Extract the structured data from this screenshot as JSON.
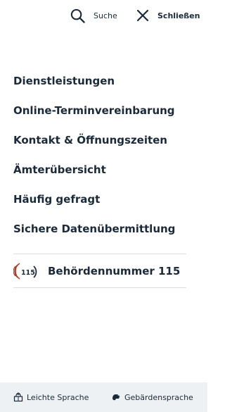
{
  "header": {
    "search_label": "Suche",
    "close_label": "Schließen"
  },
  "menu": {
    "items": [
      {
        "label": "Dienstleistungen"
      },
      {
        "label": "Online-Terminvereinbarung"
      },
      {
        "label": "Kontakt & Öffnungszeiten"
      },
      {
        "label": "Ämterübersicht"
      },
      {
        "label": "Häufig gefragt"
      },
      {
        "label": "Sichere Datenübermittlung"
      }
    ]
  },
  "phone": {
    "logo_text": "115",
    "label": "Behördennummer 115"
  },
  "footer": {
    "easy_language": "Leichte Sprache",
    "sign_language": "Gebärdensprache"
  },
  "colors": {
    "text": "#1b2a3a",
    "logo_accent": "#b23a1f",
    "footer_bg": "#eef1f4",
    "divider": "#d8dde3"
  },
  "icons": [
    "search-icon",
    "close-icon",
    "logo-115-icon",
    "easy-language-icon",
    "sign-language-icon"
  ]
}
